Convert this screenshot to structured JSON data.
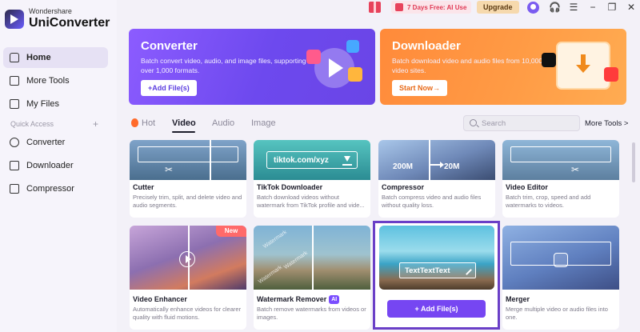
{
  "app": {
    "brand_sub": "Wondershare",
    "brand_name": "UniConverter"
  },
  "sidebar": {
    "items": [
      {
        "label": "Home",
        "icon": "home-icon",
        "active": true
      },
      {
        "label": "More Tools",
        "icon": "toolbox-icon"
      },
      {
        "label": "My Files",
        "icon": "files-icon"
      }
    ],
    "quick_access_label": "Quick Access",
    "quick_access_plus": "+",
    "quick_items": [
      {
        "label": "Converter",
        "icon": "converter-icon"
      },
      {
        "label": "Downloader",
        "icon": "downloader-icon"
      },
      {
        "label": "Compressor",
        "icon": "compressor-icon"
      }
    ]
  },
  "topbar": {
    "promo_text": "7 Days Free: AI Use",
    "upgrade_label": "Upgrade",
    "icons": [
      "gift-icon",
      "avatar",
      "headset-icon",
      "menu-icon",
      "minimize-icon",
      "restore-icon",
      "close-icon"
    ],
    "glyphs": {
      "headset": "🎧",
      "menu": "☰",
      "minimize": "−",
      "restore": "❐",
      "close": "✕"
    }
  },
  "banners": {
    "converter": {
      "title": "Converter",
      "description": "Batch convert video, audio, and image files, supporting over 1,000 formats.",
      "button_label": "+Add File(s)",
      "color": "#7a50f5"
    },
    "downloader": {
      "title": "Downloader",
      "description": "Batch download video and audio files from 10,000+ video sites.",
      "button_label": "Start Now→",
      "color": "#ff9a44"
    }
  },
  "tabs": {
    "items": [
      "Hot",
      "Video",
      "Audio",
      "Image"
    ],
    "active": "Video"
  },
  "search": {
    "placeholder": "Search"
  },
  "more_tools_label": "More Tools >",
  "cards_row1": [
    {
      "title": "Cutter",
      "description": "Precisely trim, split, and delete video and audio segments."
    },
    {
      "title": "TikTok Downloader",
      "description": "Batch download videos without watermark from TikTok profile and vide...",
      "overlay_text": "tiktok.com/xyz"
    },
    {
      "title": "Compressor",
      "description": "Batch compress video and audio files without quality loss.",
      "size_from": "200M",
      "size_to": "20M"
    },
    {
      "title": "Video Editor",
      "description": "Batch trim, crop, speed and add watermarks to videos."
    }
  ],
  "cards_row2": [
    {
      "title": "Video Enhancer",
      "description": "Automatically enhance videos for clearer quality with fluid motions.",
      "badge": "New"
    },
    {
      "title": "Watermark Remover",
      "description": "Batch remove watermarks from videos or images.",
      "badge": "AI",
      "watermark_text": "Watermark"
    },
    {
      "title": "",
      "description": "",
      "overlay_text": "TextTextText",
      "button_label": "+ Add File(s)"
    },
    {
      "title": "Merger",
      "description": "Merge multiple video or audio files into one."
    }
  ],
  "colors": {
    "accent": "#7646f2",
    "selection_frame": "#6a3fc7",
    "promo": "#e03a55",
    "upgrade_bg": "#f6d9ad"
  }
}
